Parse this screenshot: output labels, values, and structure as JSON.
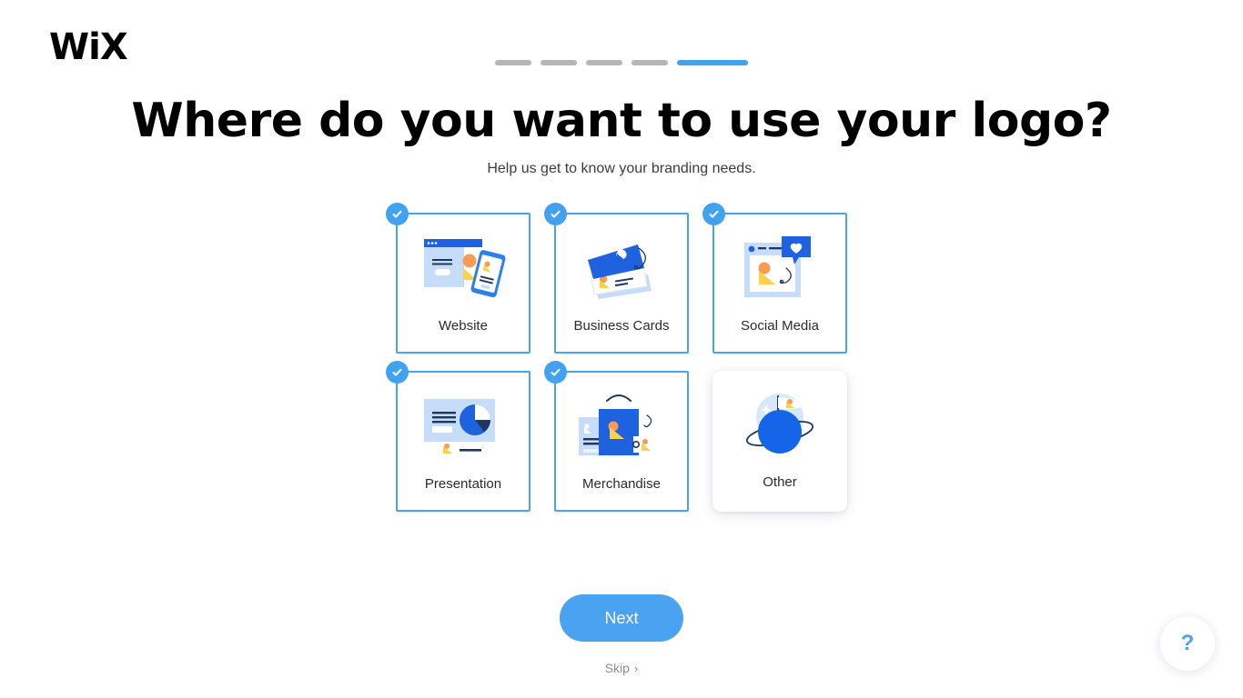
{
  "brand": {
    "logo_text": "WiX"
  },
  "progress": {
    "segments": [
      {
        "state": "done"
      },
      {
        "state": "done"
      },
      {
        "state": "done"
      },
      {
        "state": "done"
      },
      {
        "state": "active"
      }
    ],
    "current_step": 5,
    "total_steps": 5,
    "active_color": "#43a2f0",
    "inactive_color": "#b6b6b6"
  },
  "header": {
    "title": "Where do you want to use your logo?",
    "subtitle": "Help us get to know your branding needs."
  },
  "options": [
    {
      "id": "website",
      "label": "Website",
      "selected": true,
      "icon": "website-illustration"
    },
    {
      "id": "business-cards",
      "label": "Business Cards",
      "selected": true,
      "icon": "business-cards-illustration"
    },
    {
      "id": "social-media",
      "label": "Social Media",
      "selected": true,
      "icon": "social-media-illustration"
    },
    {
      "id": "presentation",
      "label": "Presentation",
      "selected": true,
      "icon": "presentation-illustration"
    },
    {
      "id": "merchandise",
      "label": "Merchandise",
      "selected": true,
      "icon": "merchandise-illustration"
    },
    {
      "id": "other",
      "label": "Other",
      "selected": false,
      "icon": "planet-illustration"
    }
  ],
  "footer": {
    "next_label": "Next",
    "skip_label": "Skip",
    "skip_chevron": "›",
    "help_label": "?"
  },
  "colors": {
    "accent_blue": "#4aa3f0",
    "deep_blue": "#1e62e0",
    "navy": "#20365e",
    "pale_blue": "#c5ddf8",
    "orange": "#f89c54",
    "yellow": "#fbd14b",
    "text_dark": "#2b2b2b",
    "text_muted": "#8d8d8d"
  }
}
